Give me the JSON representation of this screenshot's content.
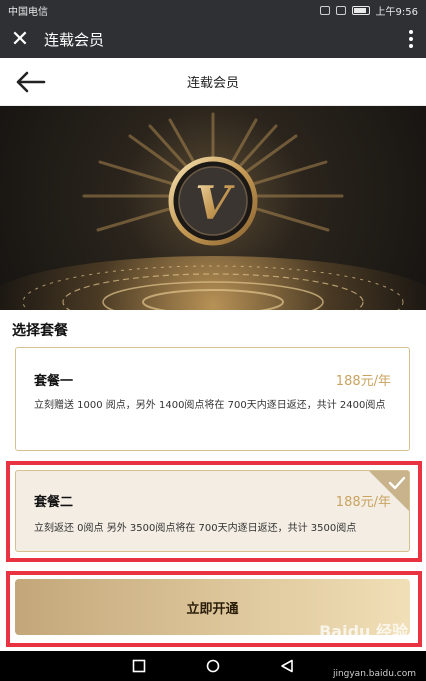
{
  "status_bar": {
    "carrier": "中国电信",
    "time": "上午9:56"
  },
  "app_bar": {
    "title": "连载会员",
    "close_icon": "close-icon",
    "more_icon": "more-vertical-icon"
  },
  "page": {
    "title": "连载会员",
    "back_icon": "arrow-left-icon"
  },
  "banner": {
    "emblem_letter": "V"
  },
  "section_title": "选择套餐",
  "plans": [
    {
      "name": "套餐一",
      "price": "188元/年",
      "description": "立刻赠送 1000 阅点，另外 1400阅点将在 700天内逐日返还，共计 2400阅点",
      "selected": false
    },
    {
      "name": "套餐二",
      "price": "188元/年",
      "description": "立刻返还 0阅点 另外 3500阅点将在 700天内逐日返还，共计 3500阅点",
      "selected": true
    }
  ],
  "activate_button": "立即开通",
  "watermark": {
    "logo": "Baidu 经验",
    "url": "jingyan.baidu.com"
  },
  "colors": {
    "gold": "#c9a461",
    "highlight": "#ea3340",
    "bar": "#2e3033"
  }
}
